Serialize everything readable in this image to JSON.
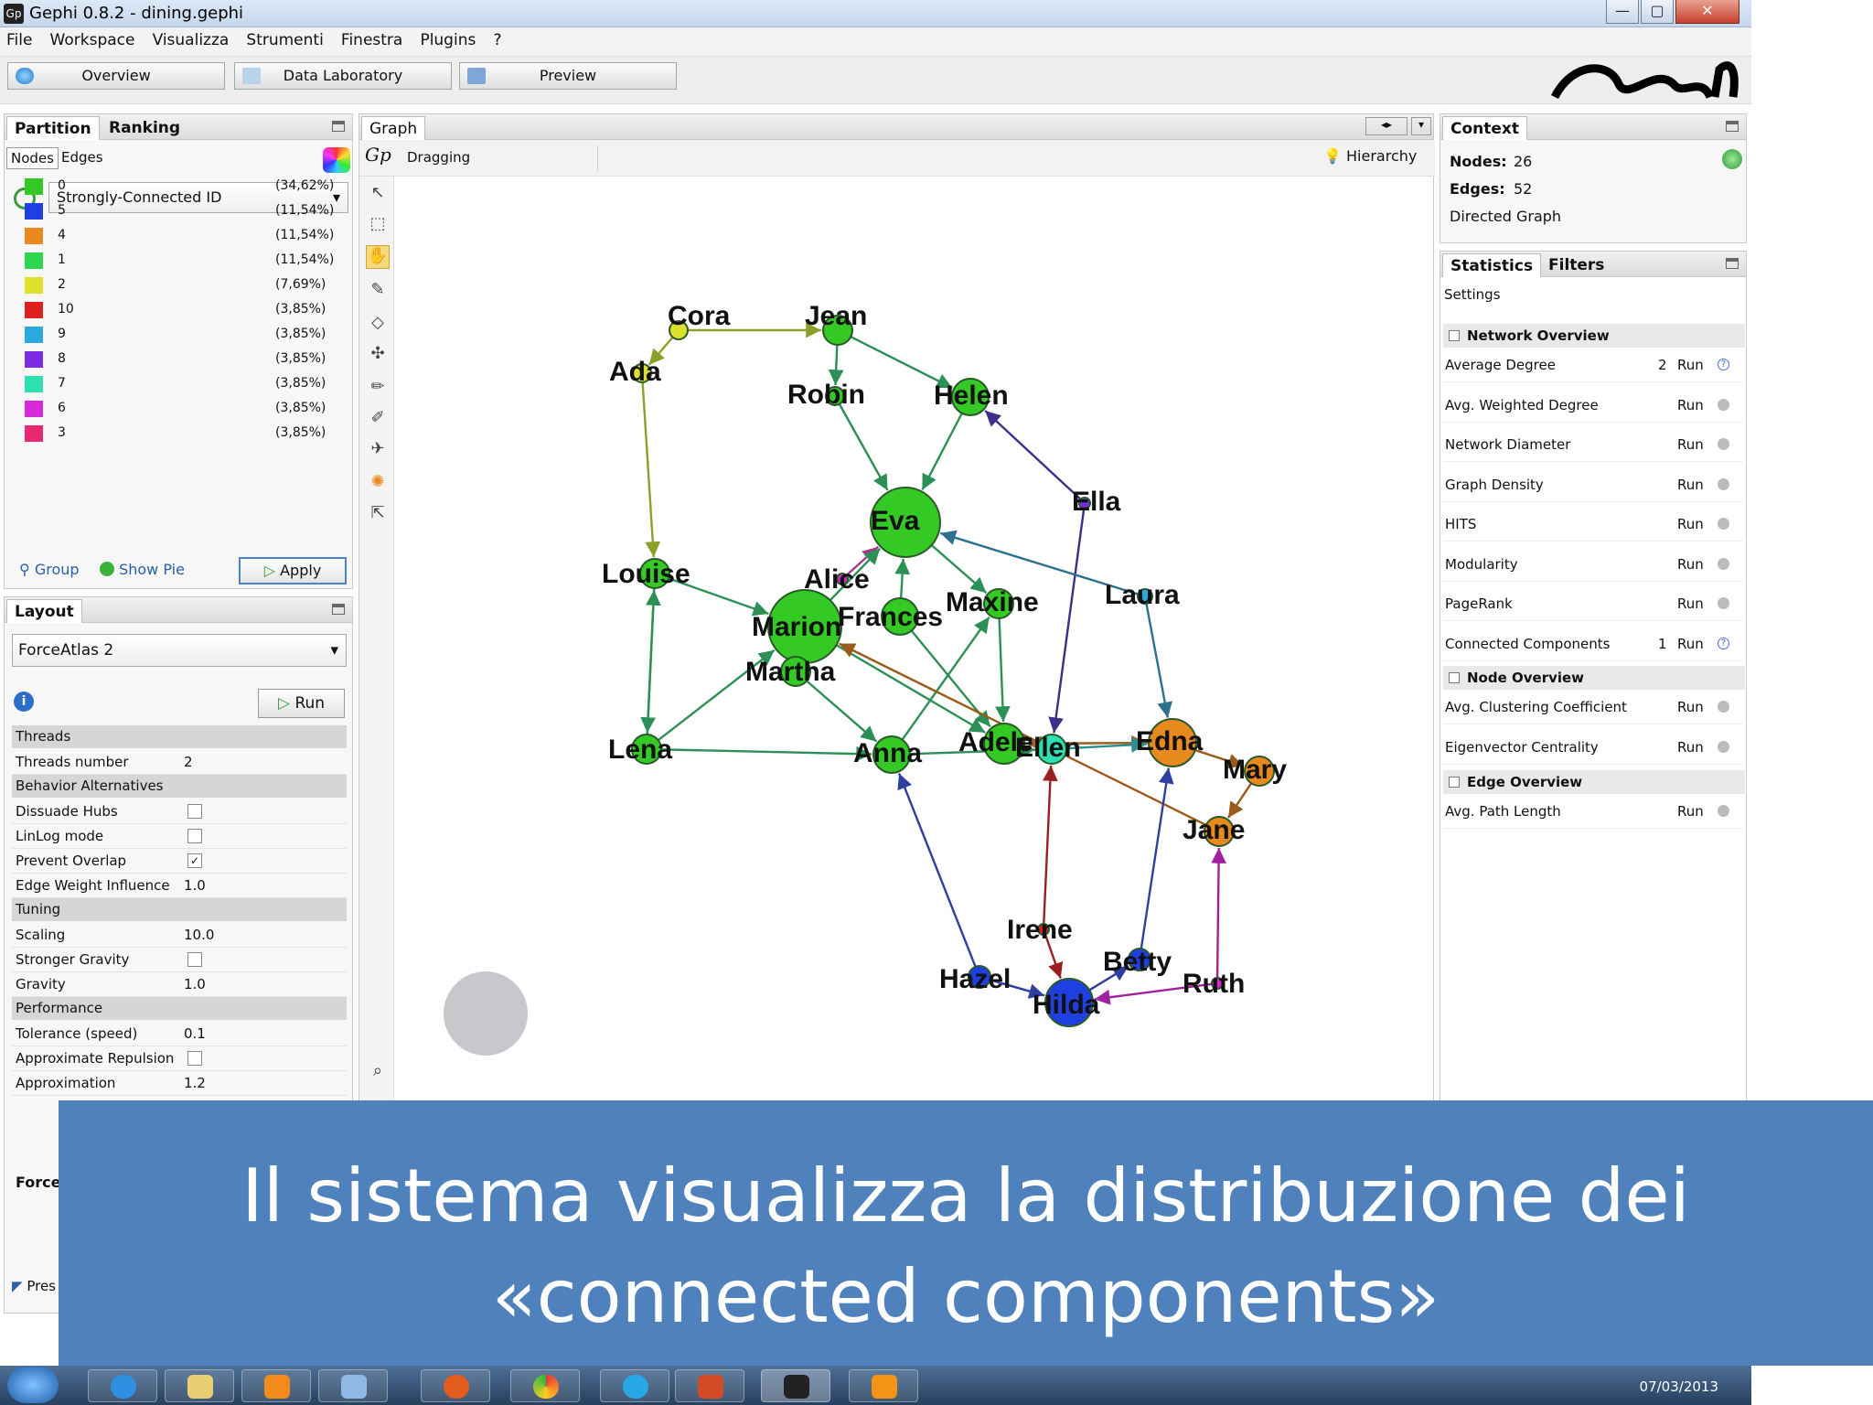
{
  "window": {
    "title": "Gephi 0.8.2 - dining.gephi",
    "close": "✕",
    "max": "▢",
    "min": "—"
  },
  "menu": [
    "File",
    "Workspace",
    "Visualizza",
    "Strumenti",
    "Finestra",
    "Plugins",
    "?"
  ],
  "modes": [
    {
      "label": "Overview"
    },
    {
      "label": "Data Laboratory"
    },
    {
      "label": "Preview"
    }
  ],
  "partition": {
    "tabs": [
      "Partition",
      "Ranking"
    ],
    "subtabs": [
      "Nodes",
      "Edges"
    ],
    "attribute": "Strongly-Connected ID",
    "legend": [
      {
        "label": "0",
        "pct": "(34,62%)",
        "color": "#34c924"
      },
      {
        "label": "5",
        "pct": "(11,54%)",
        "color": "#1f3fe0"
      },
      {
        "label": "4",
        "pct": "(11,54%)",
        "color": "#e8891e"
      },
      {
        "label": "1",
        "pct": "(11,54%)",
        "color": "#2ed650"
      },
      {
        "label": "2",
        "pct": "(7,69%)",
        "color": "#dde12b"
      },
      {
        "label": "10",
        "pct": "(3,85%)",
        "color": "#e0201f"
      },
      {
        "label": "9",
        "pct": "(3,85%)",
        "color": "#2aa8e0"
      },
      {
        "label": "8",
        "pct": "(3,85%)",
        "color": "#7a2de0"
      },
      {
        "label": "7",
        "pct": "(3,85%)",
        "color": "#2ee0b0"
      },
      {
        "label": "6",
        "pct": "(3,85%)",
        "color": "#d829d8"
      },
      {
        "label": "3",
        "pct": "(3,85%)",
        "color": "#e82870"
      }
    ],
    "group": "Group",
    "show_pie": "Show Pie",
    "apply": "Apply"
  },
  "layout": {
    "tab": "Layout",
    "algorithm": "ForceAtlas 2",
    "run": "Run",
    "sections": [
      {
        "name": "Threads",
        "rows": [
          {
            "k": "Threads number",
            "v": "2"
          }
        ]
      },
      {
        "name": "Behavior Alternatives",
        "rows": [
          {
            "k": "Dissuade Hubs",
            "cb": ""
          },
          {
            "k": "LinLog mode",
            "cb": ""
          },
          {
            "k": "Prevent Overlap",
            "cb": "✓"
          },
          {
            "k": "Edge Weight Influence",
            "v": "1.0"
          }
        ]
      },
      {
        "name": "Tuning",
        "rows": [
          {
            "k": "Scaling",
            "v": "10.0"
          },
          {
            "k": "Stronger Gravity",
            "cb": ""
          },
          {
            "k": "Gravity",
            "v": "1.0"
          }
        ]
      },
      {
        "name": "Performance",
        "rows": [
          {
            "k": "Tolerance (speed)",
            "v": "0.1"
          },
          {
            "k": "Approximate Repulsion",
            "cb": ""
          },
          {
            "k": "Approximation",
            "v": "1.2"
          }
        ]
      }
    ],
    "footer_label": "Force",
    "presets": "Pres"
  },
  "graph": {
    "tab": "Graph",
    "mode": "Dragging",
    "hierarchy": "Hierarchy",
    "nodes": [
      {
        "id": "Cora",
        "c": "#dde12b",
        "r": 10
      },
      {
        "id": "Jean",
        "c": "#34c924",
        "r": 16
      },
      {
        "id": "Ada",
        "c": "#dde12b",
        "r": 10
      },
      {
        "id": "Robin",
        "c": "#34c924",
        "r": 10
      },
      {
        "id": "Helen",
        "c": "#34c924",
        "r": 20
      },
      {
        "id": "Ella",
        "c": "#7a2de0",
        "r": 6
      },
      {
        "id": "Eva",
        "c": "#34c924",
        "r": 38
      },
      {
        "id": "Louise",
        "c": "#34c924",
        "r": 16
      },
      {
        "id": "Alice",
        "c": "#d829d8",
        "r": 6
      },
      {
        "id": "Marion",
        "c": "#34c924",
        "r": 40
      },
      {
        "id": "Frances",
        "c": "#34c924",
        "r": 20
      },
      {
        "id": "Maxine",
        "c": "#34c924",
        "r": 16
      },
      {
        "id": "Laura",
        "c": "#2aa8e0",
        "r": 8
      },
      {
        "id": "Lena",
        "c": "#34c924",
        "r": 16
      },
      {
        "id": "Martha",
        "c": "#34c924",
        "r": 16
      },
      {
        "id": "Adele",
        "c": "#34c924",
        "r": 22
      },
      {
        "id": "Edna",
        "c": "#e8891e",
        "r": 26
      },
      {
        "id": "Anna",
        "c": "#34c924",
        "r": 20
      },
      {
        "id": "Ellen",
        "c": "#2ee0b0",
        "r": 16
      },
      {
        "id": "Mary",
        "c": "#e8891e",
        "r": 16
      },
      {
        "id": "Jane",
        "c": "#e8891e",
        "r": 16
      },
      {
        "id": "Irene",
        "c": "#e0201f",
        "r": 6
      },
      {
        "id": "Betty",
        "c": "#1f3fe0",
        "r": 12
      },
      {
        "id": "Hazel",
        "c": "#1f3fe0",
        "r": 12
      },
      {
        "id": "Hilda",
        "c": "#1f3fe0",
        "r": 26
      },
      {
        "id": "Ruth",
        "c": "#d829d8",
        "r": 6
      }
    ],
    "edges": [
      [
        "Cora",
        "Jean",
        "#8aa02a"
      ],
      [
        "Cora",
        "Ada",
        "#8aa02a"
      ],
      [
        "Ada",
        "Louise",
        "#8aa02a"
      ],
      [
        "Jean",
        "Robin",
        "#2c8f55"
      ],
      [
        "Jean",
        "Helen",
        "#2c8f55"
      ],
      [
        "Robin",
        "Eva",
        "#2c8f55"
      ],
      [
        "Helen",
        "Eva",
        "#2c8f55"
      ],
      [
        "Ella",
        "Helen",
        "#3a2f8a"
      ],
      [
        "Ella",
        "Ellen",
        "#3a2f8a"
      ],
      [
        "Louise",
        "Marion",
        "#2c8f55"
      ],
      [
        "Louise",
        "Lena",
        "#2c8f55"
      ],
      [
        "Lena",
        "Louise",
        "#2c8f55"
      ],
      [
        "Lena",
        "Marion",
        "#2c8f55"
      ],
      [
        "Lena",
        "Anna",
        "#2c8f55"
      ],
      [
        "Alice",
        "Eva",
        "#a33a8a"
      ],
      [
        "Marion",
        "Eva",
        "#2c8f55"
      ],
      [
        "Marion",
        "Martha",
        "#2c8f55"
      ],
      [
        "Marion",
        "Adele",
        "#2c8f55"
      ],
      [
        "Frances",
        "Eva",
        "#2c8f55"
      ],
      [
        "Frances",
        "Adele",
        "#2c8f55"
      ],
      [
        "Eva",
        "Maxine",
        "#2c8f55"
      ],
      [
        "Maxine",
        "Adele",
        "#2c8f55"
      ],
      [
        "Laura",
        "Eva",
        "#2c6f8f"
      ],
      [
        "Laura",
        "Edna",
        "#2c6f8f"
      ],
      [
        "Martha",
        "Anna",
        "#2c8f55"
      ],
      [
        "Anna",
        "Maxine",
        "#2c8f55"
      ],
      [
        "Anna",
        "Ellen",
        "#2c8f55"
      ],
      [
        "Adele",
        "Edna",
        "#a0672a"
      ],
      [
        "Edna",
        "Adele",
        "#a0672a"
      ],
      [
        "Ellen",
        "Edna",
        "#2c8f8f"
      ],
      [
        "Edna",
        "Mary",
        "#9a5a1a"
      ],
      [
        "Mary",
        "Jane",
        "#9a5a1a"
      ],
      [
        "Jane",
        "Marion",
        "#9a5a1a"
      ],
      [
        "Irene",
        "Ellen",
        "#9a2020"
      ],
      [
        "Irene",
        "Hilda",
        "#9a2020"
      ],
      [
        "Betty",
        "Edna",
        "#2f3fa0"
      ],
      [
        "Hilda",
        "Betty",
        "#2f3fa0"
      ],
      [
        "Hazel",
        "Anna",
        "#2f3fa0"
      ],
      [
        "Hazel",
        "Hilda",
        "#2f3fa0"
      ],
      [
        "Ruth",
        "Jane",
        "#a020a0"
      ],
      [
        "Ruth",
        "Hilda",
        "#a020a0"
      ]
    ]
  },
  "context": {
    "tab": "Context",
    "nodes_label": "Nodes:",
    "nodes_value": "26",
    "edges_label": "Edges:",
    "edges_value": "52",
    "graph_type": "Directed Graph"
  },
  "statistics": {
    "tabs": [
      "Statistics",
      "Filters"
    ],
    "settings": "Settings",
    "network_overview": "Network Overview",
    "network": [
      {
        "k": "Average Degree",
        "val": "2",
        "run": "Run",
        "done": true
      },
      {
        "k": "Avg. Weighted Degree",
        "val": "",
        "run": "Run",
        "done": false
      },
      {
        "k": "Network Diameter",
        "val": "",
        "run": "Run",
        "done": false
      },
      {
        "k": "Graph Density",
        "val": "",
        "run": "Run",
        "done": false
      },
      {
        "k": "HITS",
        "val": "",
        "run": "Run",
        "done": false
      },
      {
        "k": "Modularity",
        "val": "",
        "run": "Run",
        "done": false
      },
      {
        "k": "PageRank",
        "val": "",
        "run": "Run",
        "done": false
      },
      {
        "k": "Connected Components",
        "val": "1",
        "run": "Run",
        "done": true
      }
    ],
    "node_overview": "Node Overview",
    "node": [
      {
        "k": "Avg. Clustering Coefficient",
        "val": "",
        "run": "Run",
        "done": false
      },
      {
        "k": "Eigenvector Centrality",
        "val": "",
        "run": "Run",
        "done": false
      }
    ],
    "edge_overview": "Edge Overview",
    "edge": [
      {
        "k": "Avg. Path Length",
        "val": "",
        "run": "Run",
        "done": false
      }
    ]
  },
  "overlay": {
    "text": "Il sistema visualizza la distribuzione dei «connected components»"
  },
  "taskbar": {
    "clock": "07/03/2013"
  }
}
